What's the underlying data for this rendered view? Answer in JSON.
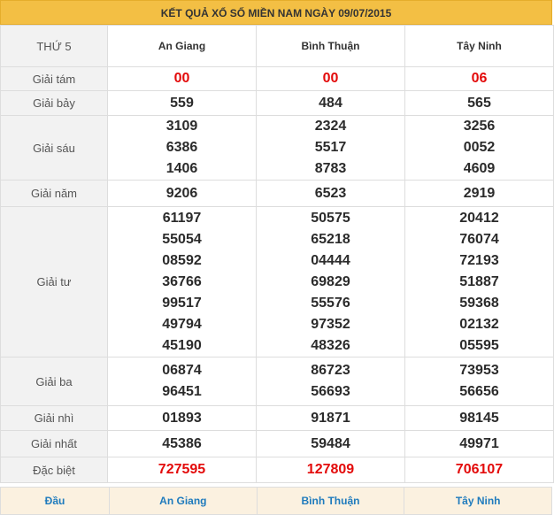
{
  "title": "KẾT QUẢ XỔ SỐ MIỀN NAM NGÀY 09/07/2015",
  "header": {
    "day": "THỨ 5",
    "provinces": [
      "An Giang",
      "Bình Thuận",
      "Tây Ninh"
    ]
  },
  "prizes": [
    {
      "label": "Giải tám",
      "red": true,
      "results": [
        [
          "00"
        ],
        [
          "00"
        ],
        [
          "06"
        ]
      ]
    },
    {
      "label": "Giải bảy",
      "red": false,
      "results": [
        [
          "559"
        ],
        [
          "484"
        ],
        [
          "565"
        ]
      ]
    },
    {
      "label": "Giải sáu",
      "red": false,
      "results": [
        [
          "3109",
          "6386",
          "1406"
        ],
        [
          "2324",
          "5517",
          "8783"
        ],
        [
          "3256",
          "0052",
          "4609"
        ]
      ]
    },
    {
      "label": "Giải năm",
      "red": false,
      "results": [
        [
          "9206"
        ],
        [
          "6523"
        ],
        [
          "2919"
        ]
      ]
    },
    {
      "label": "Giải tư",
      "red": false,
      "results": [
        [
          "61197",
          "55054",
          "08592",
          "36766",
          "99517",
          "49794",
          "45190"
        ],
        [
          "50575",
          "65218",
          "04444",
          "69829",
          "55576",
          "97352",
          "48326"
        ],
        [
          "20412",
          "76074",
          "72193",
          "51887",
          "59368",
          "02132",
          "05595"
        ]
      ]
    },
    {
      "label": "Giải ba",
      "red": false,
      "results": [
        [
          "06874",
          "96451"
        ],
        [
          "86723",
          "56693"
        ],
        [
          "73953",
          "56656"
        ]
      ]
    },
    {
      "label": "Giải nhì",
      "red": false,
      "results": [
        [
          "01893"
        ],
        [
          "91871"
        ],
        [
          "98145"
        ]
      ]
    },
    {
      "label": "Giải nhất",
      "red": false,
      "results": [
        [
          "45386"
        ],
        [
          "59484"
        ],
        [
          "49971"
        ]
      ]
    },
    {
      "label": "Đặc biệt",
      "red": true,
      "results": [
        [
          "727595"
        ],
        [
          "127809"
        ],
        [
          "706107"
        ]
      ]
    }
  ],
  "bottom": {
    "head_label": "Đầu",
    "provinces": [
      "An Giang",
      "Bình Thuận",
      "Tây Ninh"
    ]
  },
  "colors": {
    "title_bg": "#f3bf44",
    "label_bg": "#f2f2f2",
    "special_red": "#e30b0b",
    "bottom_link": "#1f7bbd"
  }
}
